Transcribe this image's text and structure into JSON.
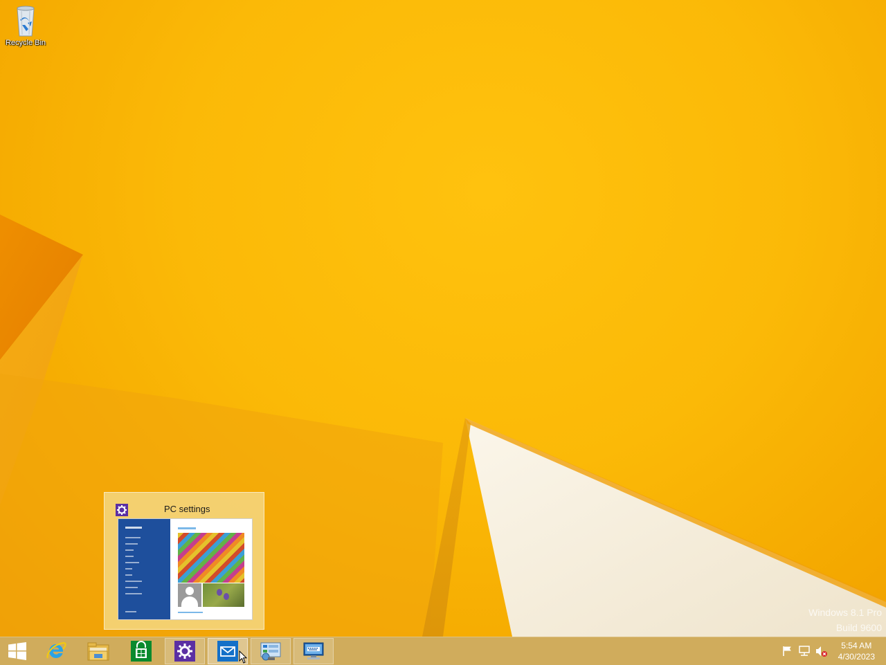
{
  "desktop": {
    "icons": [
      {
        "label": "Recycle Bin",
        "icon": "recycle-bin-icon"
      }
    ],
    "watermark": {
      "line1": "Windows 8.1 Pro",
      "line2": "Build 9600"
    }
  },
  "thumbnail_popup": {
    "title": "PC settings",
    "icon": "gear-icon",
    "preview_app": "PC settings"
  },
  "taskbar": {
    "start": {
      "icon": "windows-start-icon"
    },
    "pinned": [
      {
        "name": "internet-explorer",
        "icon": "ie-icon"
      },
      {
        "name": "file-explorer",
        "icon": "folder-icon"
      },
      {
        "name": "store",
        "icon": "store-icon"
      },
      {
        "name": "pc-settings",
        "icon": "gear-icon",
        "state": "running"
      },
      {
        "name": "mail",
        "icon": "mail-icon",
        "state": "active"
      },
      {
        "name": "control-panel",
        "icon": "control-panel-icon",
        "state": "running"
      },
      {
        "name": "remote-desktop",
        "icon": "remote-desktop-icon",
        "state": "running"
      }
    ],
    "tray": {
      "icons": [
        "action-center-flag-icon",
        "network-icon",
        "volume-muted-icon"
      ],
      "time": "5:54 AM",
      "date": "4/30/2023"
    }
  },
  "colors": {
    "wallpaper": "#fbb907",
    "taskbar": "#ceac60",
    "gear_accent": "#5b2fa3",
    "settings_blue": "#1e4f9c"
  }
}
